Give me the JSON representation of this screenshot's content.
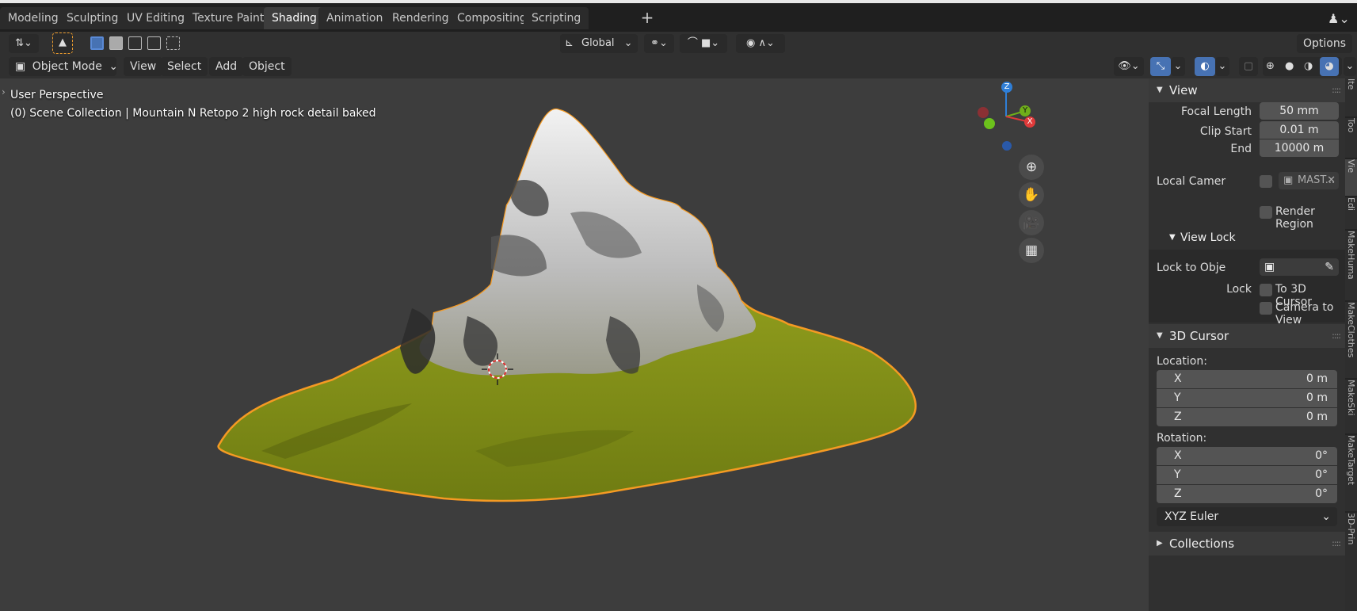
{
  "workspace_tabs": [
    "Modeling",
    "Sculpting",
    "UV Editing",
    "Texture Paint",
    "Shading",
    "Animation",
    "Rendering",
    "Compositing",
    "Scripting"
  ],
  "active_tab": "Shading",
  "toolbar": {
    "orientation": "Global",
    "options_label": "Options"
  },
  "header": {
    "mode": "Object Mode",
    "menus": [
      "View",
      "Select",
      "Add",
      "Object"
    ]
  },
  "viewport": {
    "perspective": "User Perspective",
    "collection_info": "(0) Scene Collection | Mountain N Retopo 2 high rock detail baked",
    "gizmo": {
      "z": "Z",
      "y": "Y",
      "x": "X"
    }
  },
  "npanel": {
    "view": {
      "title": "View",
      "focal_length_label": "Focal Length",
      "focal_length": "50 mm",
      "clip_start_label": "Clip Start",
      "clip_start": "0.01 m",
      "end_label": "End",
      "end": "10000 m",
      "local_camera_label": "Local Camer",
      "local_camera_value": "MAST...",
      "render_region_label": "Render Region",
      "view_lock_title": "View Lock",
      "lock_to_object_label": "Lock to Obje",
      "lock_label": "Lock",
      "to_3d_cursor_label": "To 3D Cursor",
      "camera_to_view_label": "Camera to View"
    },
    "cursor": {
      "title": "3D Cursor",
      "location_label": "Location:",
      "location": [
        {
          "axis": "X",
          "value": "0 m"
        },
        {
          "axis": "Y",
          "value": "0 m"
        },
        {
          "axis": "Z",
          "value": "0 m"
        }
      ],
      "rotation_label": "Rotation:",
      "rotation": [
        {
          "axis": "X",
          "value": "0°"
        },
        {
          "axis": "Y",
          "value": "0°"
        },
        {
          "axis": "Z",
          "value": "0°"
        }
      ],
      "rotation_mode": "XYZ Euler"
    },
    "collections_title": "Collections",
    "side_tabs": [
      "Ite",
      "Too",
      "Vie",
      "Edi",
      "MakeHuma",
      "MakeClothes",
      "MakeSki",
      "MakeTarget",
      "3D-Prin"
    ]
  },
  "colors": {
    "active_blue": "#4772b3",
    "selection_outline": "#f59a23",
    "grass": "#8f9c1e"
  }
}
